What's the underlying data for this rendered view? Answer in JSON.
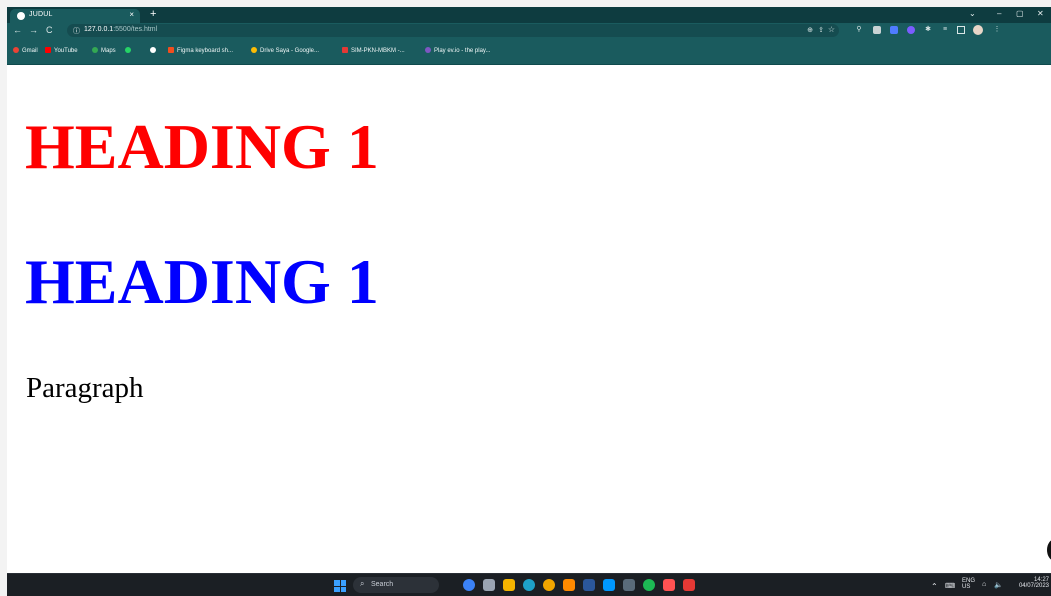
{
  "browser": {
    "tab_title": "JUDUL",
    "tab_close": "×",
    "new_tab": "+",
    "window_controls": [
      "⌄",
      "–",
      "▢",
      "✕"
    ],
    "url_host": "127.0.0.1",
    "url_path": ":5500/tes.html",
    "bookmarks": [
      {
        "label": "Gmail",
        "icon": "gmail-icon",
        "color": "#ea4335"
      },
      {
        "label": "YouTube",
        "icon": "youtube-icon",
        "color": "#ff0000"
      },
      {
        "label": "Maps",
        "icon": "maps-icon",
        "color": "#34a853"
      },
      {
        "label": "",
        "icon": "whatsapp-icon",
        "color": "#25d366"
      },
      {
        "label": "",
        "icon": "github-icon",
        "color": "#ffffff"
      },
      {
        "label": "Figma keyboard sh...",
        "icon": "figma-icon",
        "color": "#f24e1e"
      },
      {
        "label": "Drive Saya - Google...",
        "icon": "drive-icon",
        "color": "#fbbc04"
      },
      {
        "label": "SIM-PKN-MBKM -...",
        "icon": "sim-icon",
        "color": "#e53935"
      },
      {
        "label": "Play ev.io - the play...",
        "icon": "evio-icon",
        "color": "#7e57c2"
      }
    ]
  },
  "page": {
    "heading_red": "HEADING 1",
    "heading_blue": "HEADING 1",
    "paragraph": "Paragraph",
    "colors": {
      "heading_red": "#ff0000",
      "heading_blue": "#0000ff"
    }
  },
  "taskbar": {
    "search_label": "Search",
    "apps": [
      {
        "icon": "chat-icon",
        "color": "#3b82f6"
      },
      {
        "icon": "task-view-icon",
        "color": "#9aa4b2"
      },
      {
        "icon": "file-explorer-icon",
        "color": "#f4b400"
      },
      {
        "icon": "edge-icon",
        "color": "#1ea1c8"
      },
      {
        "icon": "chrome-icon",
        "color": "#f2a600"
      },
      {
        "icon": "paint-icon",
        "color": "#ff8a00"
      },
      {
        "icon": "word-icon",
        "color": "#2b579a"
      },
      {
        "icon": "vscode-icon",
        "color": "#0098ff"
      },
      {
        "icon": "terminal-icon",
        "color": "#5a6b7a"
      },
      {
        "icon": "spotify-icon",
        "color": "#1db954"
      },
      {
        "icon": "star-app-icon",
        "color": "#ff5252"
      },
      {
        "icon": "recorder-icon",
        "color": "#e53935"
      }
    ],
    "lang_top": "ENG",
    "lang_bottom": "US",
    "time": "14:27",
    "date": "04/07/2023"
  }
}
